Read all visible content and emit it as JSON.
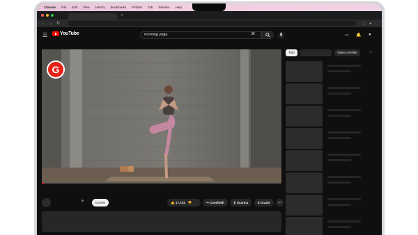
{
  "menubar": {
    "app": "Chrome",
    "items": [
      "File",
      "Edit",
      "View",
      "History",
      "Bookmarks",
      "Profiles",
      "Tab",
      "Window",
      "Help"
    ]
  },
  "browser": {
    "new_tab": "+",
    "back": "←",
    "forward": "→",
    "reload": "↻"
  },
  "youtube": {
    "logo_text": "YouTube",
    "search": {
      "value": "morning yoga",
      "clear": "✕"
    },
    "badge_letter": "G",
    "progress": 0.01,
    "actions": {
      "subscribe": "Iscriviti",
      "likes": "17.741",
      "share": "Condividi",
      "download": "Scarica",
      "thanks": "Grazie",
      "more": "⋯"
    },
    "sidebar": {
      "chip_all": "Tutti",
      "chip_related": "Video correlati",
      "chip_next": "›"
    }
  },
  "colors": {
    "brand_red": "#ff0000",
    "badge_red": "#e62117"
  },
  "icons": [
    "apple-icon",
    "hamburger-icon",
    "search-icon",
    "mic-icon",
    "create-icon",
    "bell-icon",
    "avatar-icon",
    "thumbs-up-icon",
    "thumbs-down-icon",
    "share-icon",
    "download-icon",
    "thanks-icon"
  ]
}
